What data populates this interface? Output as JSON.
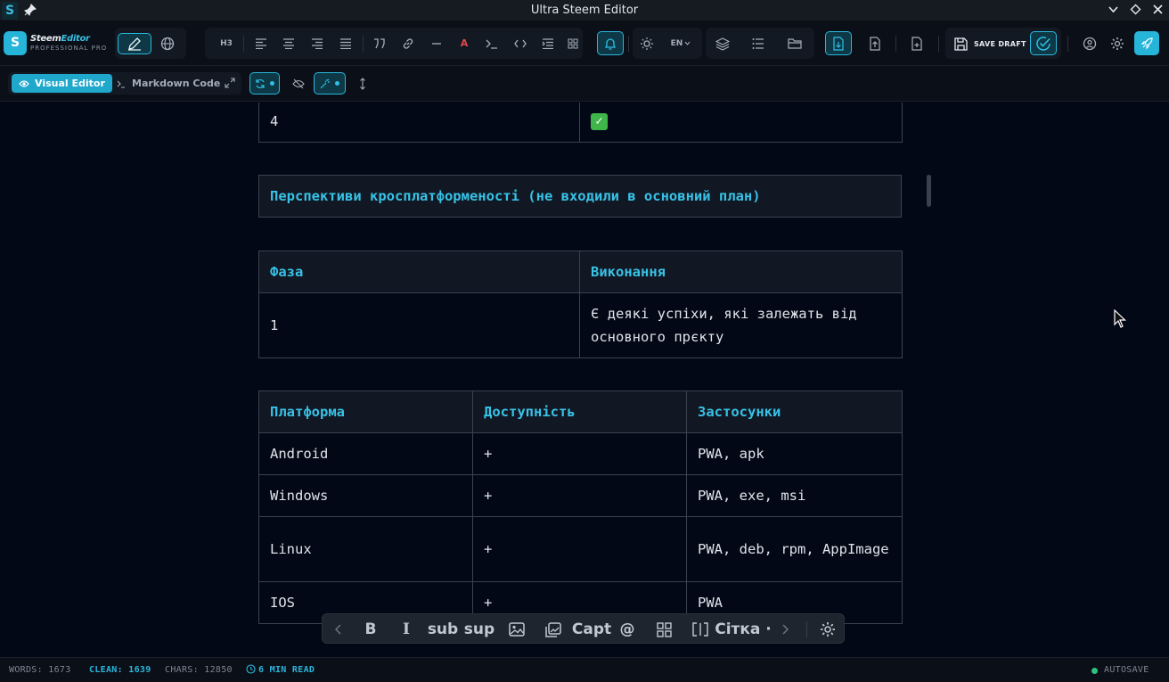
{
  "window": {
    "title": "Ultra Steem Editor"
  },
  "brand": {
    "logo_letter": "S",
    "name_a": "Steem",
    "name_b": "Editor",
    "tagline": "PROFESSIONAL PRO"
  },
  "toolbar": {
    "heading_label": "H3",
    "lang_label": "EN",
    "save_draft_label": "SAVE DRAFT",
    "icons": [
      "pen-icon",
      "globe-icon",
      "align-left-icon",
      "align-center-icon",
      "align-right-icon",
      "align-justify-icon",
      "quote-icon",
      "link-icon",
      "horizontal-rule-icon",
      "text-color-icon",
      "terminal-icon",
      "code-icon",
      "indent-icon",
      "grid-icon",
      "bell-icon",
      "sun-icon",
      "layers-icon",
      "list-icon",
      "folder-icon",
      "download-icon",
      "upload-icon",
      "export-icon",
      "save-icon",
      "check-circle-icon",
      "shield-user-icon",
      "gear-icon",
      "rocket-icon"
    ]
  },
  "modes": {
    "visual": "Visual Editor",
    "markdown": "Markdown Code"
  },
  "content": {
    "prev_table_last_row": [
      "4",
      "✓"
    ],
    "callout": "Перспективи кросплатформеності (не входили в основний план)",
    "phase_table": {
      "headers": [
        "Фаза",
        "Виконання"
      ],
      "rows": [
        [
          "1",
          "Є деякі успіхи, які залежать від основного прєкту"
        ]
      ]
    },
    "platform_table": {
      "headers": [
        "Платформа",
        "Доступність",
        "Застосунки"
      ],
      "rows": [
        [
          "Android",
          "+",
          "PWA, apk"
        ],
        [
          "Windows",
          "+",
          "PWA, exe, msi"
        ],
        [
          "Linux",
          "+",
          "PWA, deb, rpm, AppImage"
        ],
        [
          "IOS",
          "+",
          "PWA"
        ]
      ]
    }
  },
  "floatbar": {
    "bold": "B",
    "italic": "I",
    "sub": "sub",
    "sup": "sup",
    "caption": "Capt",
    "mention": "@",
    "grid": "Сітка ·"
  },
  "status": {
    "words": "WORDS: 1673",
    "clean": "CLEAN: 1639",
    "chars": "CHARS: 12850",
    "read": "6 MIN READ",
    "autosave": "AUTOSAVE"
  },
  "colors": {
    "accent": "#26b5d9",
    "background": "#030816",
    "table_border": "#3a4250",
    "check_green": "#3fb54a"
  }
}
